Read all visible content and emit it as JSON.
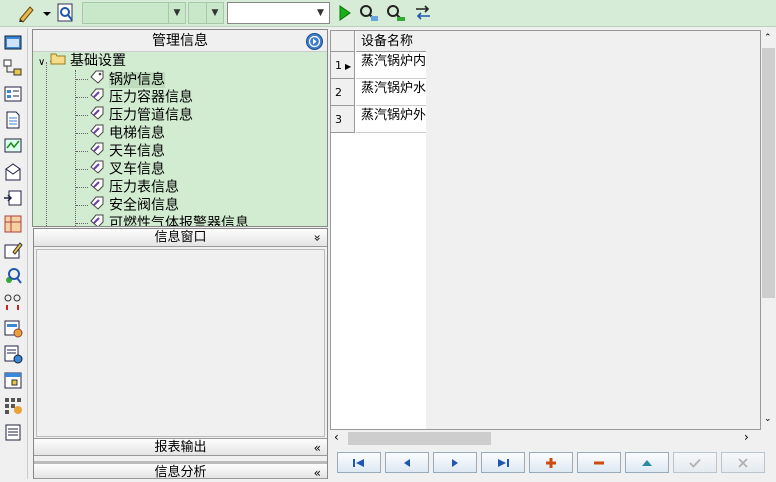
{
  "nav_panel": {
    "title": "管理信息",
    "root": "基础设置",
    "items": [
      "锅炉信息",
      "压力容器信息",
      "压力管道信息",
      "电梯信息",
      "天车信息",
      "叉车信息",
      "压力表信息",
      "安全阀信息",
      "可燃性气体报警器信息"
    ]
  },
  "info_panel": {
    "header": "信息窗口",
    "collapse_glyph": "»",
    "report_label": "报表输出",
    "analysis_label": "信息分析",
    "expand_glyph": "«"
  },
  "grid": {
    "column_header": "设备名称",
    "rows": [
      {
        "num": "1",
        "name": "蒸汽锅炉内"
      },
      {
        "num": "2",
        "name": "蒸汽锅炉水"
      },
      {
        "num": "3",
        "name": "蒸汽锅炉外"
      }
    ]
  },
  "colors": {
    "accent_green": "#d2ecd2",
    "toolbar_green": "#d6ecd6"
  }
}
